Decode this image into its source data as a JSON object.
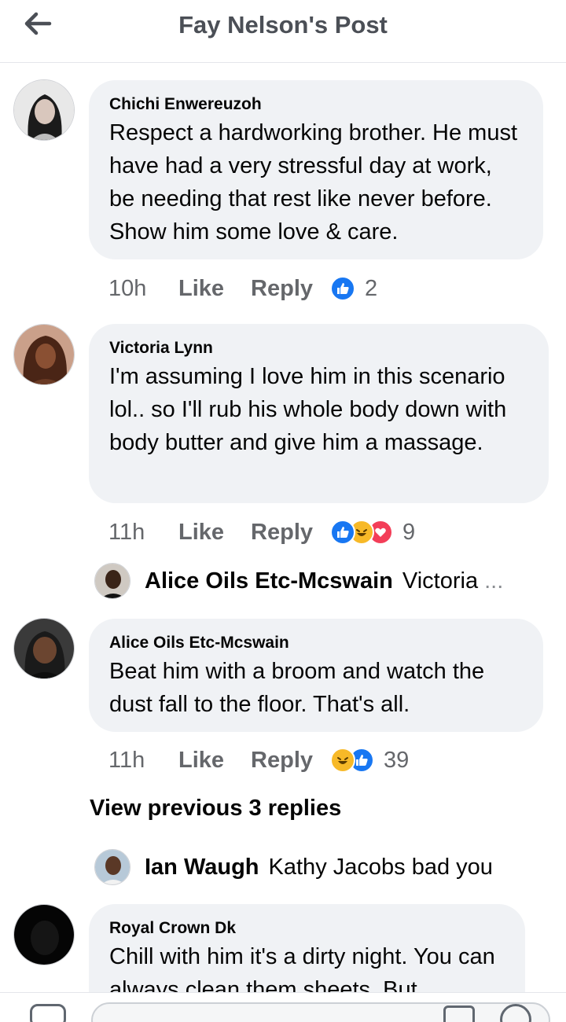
{
  "header": {
    "title": "Fay Nelson's Post"
  },
  "comments": [
    {
      "author": "Chichi Enwereuzoh",
      "text": "Respect a hardworking brother. He must have had a very stressful day at work, be needing that rest like never before. Show him some love & care.",
      "time": "10h",
      "like_label": "Like",
      "reply_label": "Reply",
      "reaction_count": "2"
    },
    {
      "author": "Victoria Lynn",
      "text": "I'm assuming I love him in this scenario lol.. so I'll rub his whole body down with body butter and give him a massage.",
      "time": "11h",
      "like_label": "Like",
      "reply_label": "Reply",
      "reaction_count": "9"
    },
    {
      "author": "Alice Oils Etc-Mcswain",
      "text": "Beat him with a broom and watch the dust fall to the floor. That's all.",
      "time": "11h",
      "like_label": "Like",
      "reply_label": "Reply",
      "reaction_count": "39"
    },
    {
      "author": "Royal Crown Dk",
      "text": "Chill with him it's a dirty night. You can always clean them sheets. But"
    }
  ],
  "reply_previews": [
    {
      "name": "Alice Oils Etc-Mcswain",
      "text": "Victoria",
      "ellipsis": "..."
    },
    {
      "name": "Ian Waugh",
      "text": "Kathy Jacobs bad you"
    }
  ],
  "view_previous": "View previous 3 replies",
  "colors": {
    "like_blue": "#1877f2",
    "haha_yellow": "#f7b928",
    "love_red": "#f33e58",
    "bubble_bg": "#f0f2f5",
    "secondary_text": "#65676b"
  },
  "icons": [
    "back-arrow-icon",
    "like-reaction-icon",
    "haha-reaction-icon",
    "love-reaction-icon",
    "camera-icon",
    "gif-icon",
    "emoji-icon"
  ]
}
